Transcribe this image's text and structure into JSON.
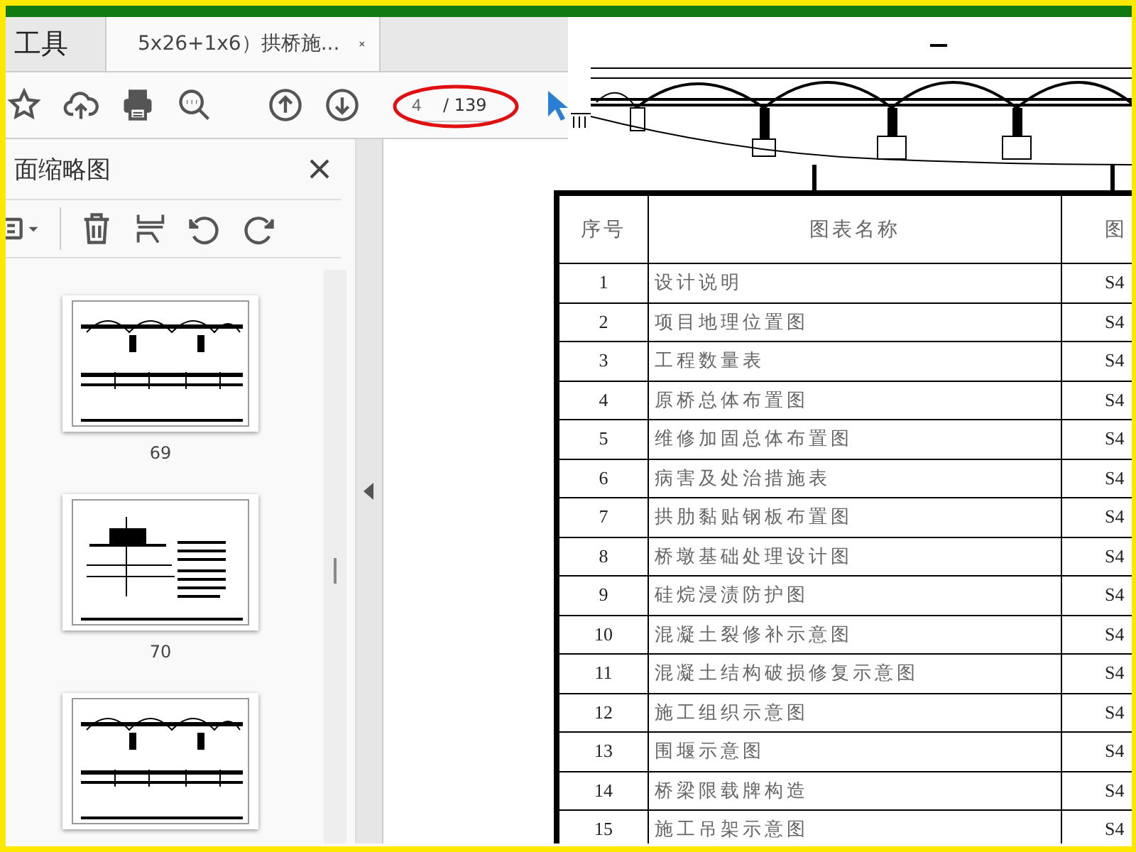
{
  "tabs": [
    {
      "label": "工具",
      "selected": false,
      "closable": false
    },
    {
      "label": "5x26+1x6）拱桥施...",
      "selected": true,
      "closable": true
    }
  ],
  "toolbar": {
    "page_value": "4",
    "page_total": "/ 139"
  },
  "sidebar": {
    "title": "面缩略图",
    "thumbnails": [
      {
        "kind": "elevation",
        "label": "69"
      },
      {
        "kind": "notes",
        "label": "70"
      },
      {
        "kind": "elevation"
      }
    ]
  },
  "table": {
    "columns": [
      "序号",
      "图表名称",
      "图"
    ],
    "rows": [
      {
        "no": "1",
        "name": "设计说明",
        "code": "S4"
      },
      {
        "no": "2",
        "name": "项目地理位置图",
        "code": "S4"
      },
      {
        "no": "3",
        "name": "工程数量表",
        "code": "S4"
      },
      {
        "no": "4",
        "name": "原桥总体布置图",
        "code": "S4"
      },
      {
        "no": "5",
        "name": "维修加固总体布置图",
        "code": "S4"
      },
      {
        "no": "6",
        "name": "病害及处治措施表",
        "code": "S4"
      },
      {
        "no": "7",
        "name": "拱肋黏贴钢板布置图",
        "code": "S4"
      },
      {
        "no": "8",
        "name": "桥墩基础处理设计图",
        "code": "S4"
      },
      {
        "no": "9",
        "name": "硅烷浸渍防护图",
        "code": "S4"
      },
      {
        "no": "10",
        "name": "混凝土裂修补示意图",
        "code": "S4"
      },
      {
        "no": "11",
        "name": "混凝土结构破损修复示意图",
        "code": "S4"
      },
      {
        "no": "12",
        "name": "施工组织示意图",
        "code": "S4"
      },
      {
        "no": "13",
        "name": "围堰示意图",
        "code": "S4"
      },
      {
        "no": "14",
        "name": "桥梁限载牌构造",
        "code": "S4"
      },
      {
        "no": "15",
        "name": "施工吊架示意图",
        "code": "S4"
      }
    ]
  }
}
